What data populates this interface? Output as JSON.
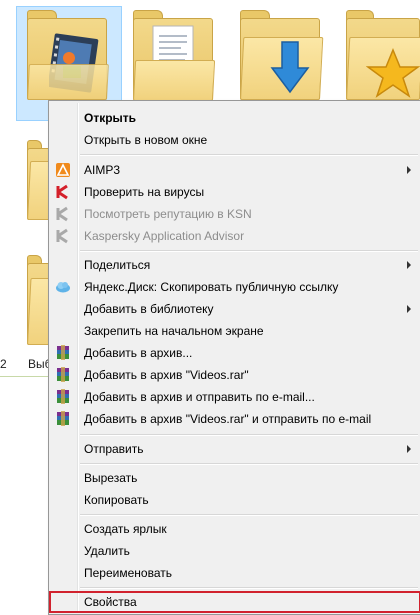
{
  "explorer": {
    "peek_labels": [
      "2",
      "Выб"
    ],
    "folder_icons": [
      "video-folder",
      "documents-folder",
      "downloads-folder",
      "favorites-folder"
    ]
  },
  "menu": {
    "items": [
      {
        "label": "Открыть",
        "icon": "",
        "bold": true
      },
      {
        "label": "Открыть в новом окне",
        "icon": ""
      },
      {
        "label": "AIMP3",
        "icon": "aimp-icon",
        "submenu": true
      },
      {
        "label": "Проверить на вирусы",
        "icon": "kaspersky-icon"
      },
      {
        "label": "Посмотреть репутацию в KSN",
        "icon": "kaspersky-gray-icon",
        "disabled": true
      },
      {
        "label": "Kaspersky Application Advisor",
        "icon": "kaspersky-gray-icon",
        "disabled": true
      },
      {
        "label": "Поделиться",
        "icon": "",
        "submenu": true
      },
      {
        "label": "Яндекс.Диск: Скопировать публичную ссылку",
        "icon": "yandex-disk-icon"
      },
      {
        "label": "Добавить в библиотеку",
        "icon": "",
        "submenu": true
      },
      {
        "label": "Закрепить на начальном экране",
        "icon": ""
      },
      {
        "label": "Добавить в архив...",
        "icon": "winrar-icon"
      },
      {
        "label": "Добавить в архив \"Videos.rar\"",
        "icon": "winrar-icon"
      },
      {
        "label": "Добавить в архив и отправить по e-mail...",
        "icon": "winrar-icon"
      },
      {
        "label": "Добавить в архив \"Videos.rar\" и отправить по e-mail",
        "icon": "winrar-icon"
      },
      {
        "label": "Отправить",
        "icon": "",
        "submenu": true
      },
      {
        "label": "Вырезать",
        "icon": ""
      },
      {
        "label": "Копировать",
        "icon": ""
      },
      {
        "label": "Создать ярлык",
        "icon": ""
      },
      {
        "label": "Удалить",
        "icon": ""
      },
      {
        "label": "Переименовать",
        "icon": ""
      },
      {
        "label": "Свойства",
        "icon": "",
        "highlighted": true
      }
    ]
  },
  "colors": {
    "menu_bg": "#f0f0f0",
    "highlight_border": "#d1222e",
    "selection_bg": "#cce8ff"
  }
}
